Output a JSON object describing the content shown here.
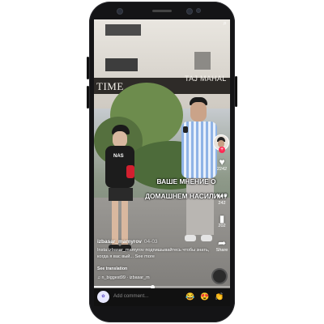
{
  "colors": {
    "accent": "#fe2c55",
    "overlay_text": "#ffffff"
  },
  "storefront": {
    "left_sign": "TIME",
    "right_sign": "TAJ MAHAL"
  },
  "video": {
    "caption_overlay_line1": "ВАШЕ МНЕНИЕ О",
    "caption_overlay_line2": "ДОМАШНЕМ НАСИЛИИ?",
    "progress_fraction": 0.43
  },
  "actions": {
    "like_count": "2242",
    "comment_count": "242",
    "save_count": "202",
    "share_label": "Share",
    "like_icon": "heart-icon",
    "comment_icon": "comment-icon",
    "save_icon": "bookmark-icon",
    "share_icon": "share-icon"
  },
  "post": {
    "username": "izbasar_mamyrov",
    "date": "04-03",
    "description": "Insta:izbasar_mamyrov подпишывайтесь чтобы знать, когда я вас вый... See more",
    "see_more": "See more",
    "see_translation": "See translation",
    "music": "♫ n_biggest99 · izbasar_m"
  },
  "bottom_bar": {
    "comment_placeholder": "Add comment...",
    "emojis": [
      "😂",
      "😍",
      "👏"
    ]
  }
}
